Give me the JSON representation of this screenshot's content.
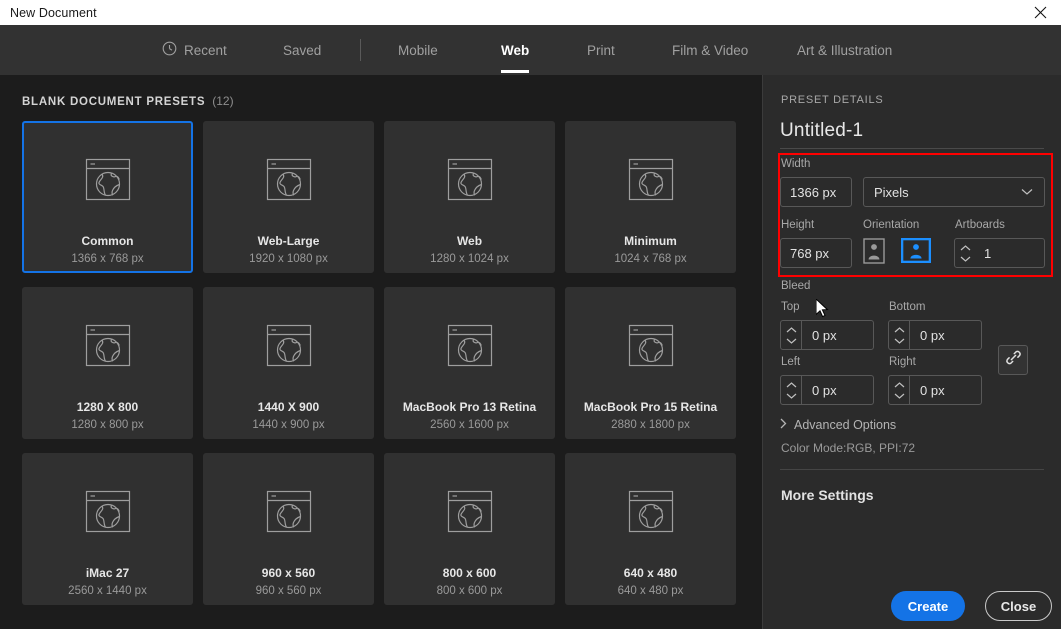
{
  "window": {
    "title": "New Document",
    "close_icon": "close-x-icon"
  },
  "tabs": [
    {
      "label": "Recent",
      "icon": "clock-icon",
      "active": false
    },
    {
      "label": "Saved",
      "icon": null,
      "active": false
    },
    {
      "label": "Mobile",
      "icon": null,
      "active": false
    },
    {
      "label": "Web",
      "icon": null,
      "active": true
    },
    {
      "label": "Print",
      "icon": null,
      "active": false
    },
    {
      "label": "Film & Video",
      "icon": null,
      "active": false
    },
    {
      "label": "Art & Illustration",
      "icon": null,
      "active": false
    }
  ],
  "presets_section": {
    "title": "BLANK DOCUMENT PRESETS",
    "count": "(12)",
    "items": [
      {
        "name": "Common",
        "dimensions": "1366 x 768 px",
        "icon": "browser-globe-icon",
        "selected": true
      },
      {
        "name": "Web-Large",
        "dimensions": "1920 x 1080 px",
        "icon": "browser-globe-icon",
        "selected": false
      },
      {
        "name": "Web",
        "dimensions": "1280 x 1024 px",
        "icon": "browser-globe-icon",
        "selected": false
      },
      {
        "name": "Minimum",
        "dimensions": "1024 x 768 px",
        "icon": "browser-globe-icon",
        "selected": false
      },
      {
        "name": "1280 X 800",
        "dimensions": "1280 x 800 px",
        "icon": "browser-globe-icon",
        "selected": false
      },
      {
        "name": "1440 X 900",
        "dimensions": "1440 x 900 px",
        "icon": "browser-globe-icon",
        "selected": false
      },
      {
        "name": "MacBook Pro 13 Retina",
        "dimensions": "2560 x 1600 px",
        "icon": "browser-globe-icon",
        "selected": false
      },
      {
        "name": "MacBook Pro 15 Retina",
        "dimensions": "2880 x 1800 px",
        "icon": "browser-globe-icon",
        "selected": false
      },
      {
        "name": "iMac 27",
        "dimensions": "2560 x 1440 px",
        "icon": "browser-globe-icon",
        "selected": false
      },
      {
        "name": "960 x 560",
        "dimensions": "960 x 560 px",
        "icon": "browser-globe-icon",
        "selected": false
      },
      {
        "name": "800 x 600",
        "dimensions": "800 x 600 px",
        "icon": "browser-globe-icon",
        "selected": false
      },
      {
        "name": "640 x 480",
        "dimensions": "640 x 480 px",
        "icon": "browser-globe-icon",
        "selected": false
      }
    ]
  },
  "preset_details": {
    "header": "PRESET DETAILS",
    "document_name": "Untitled-1",
    "width": {
      "label": "Width",
      "value": "1366 px"
    },
    "units": {
      "value": "Pixels",
      "icon": "chevron-down-icon"
    },
    "height": {
      "label": "Height",
      "value": "768 px"
    },
    "orientation": {
      "label": "Orientation",
      "portrait_icon": "portrait-orientation-icon",
      "landscape_icon": "landscape-orientation-icon",
      "selected": "landscape"
    },
    "artboards": {
      "label": "Artboards",
      "value": "1"
    },
    "bleed": {
      "label": "Bleed",
      "top": {
        "label": "Top",
        "value": "0 px"
      },
      "bottom": {
        "label": "Bottom",
        "value": "0 px"
      },
      "left": {
        "label": "Left",
        "value": "0 px"
      },
      "right": {
        "label": "Right",
        "value": "0 px"
      },
      "link_icon": "chain-link-icon"
    },
    "advanced_options": {
      "label": "Advanced Options",
      "icon": "chevron-right-icon"
    },
    "color_mode_summary": "Color Mode:RGB, PPI:72",
    "more_settings": "More Settings"
  },
  "actions": {
    "create": "Create",
    "close": "Close"
  },
  "colors": {
    "accent_blue": "#1473e6",
    "highlight_red": "#ff0000",
    "panel_bg": "#2b2b2b",
    "content_bg": "#1c1c1c",
    "tabbar_bg": "#323232",
    "card_bg": "#303030"
  }
}
